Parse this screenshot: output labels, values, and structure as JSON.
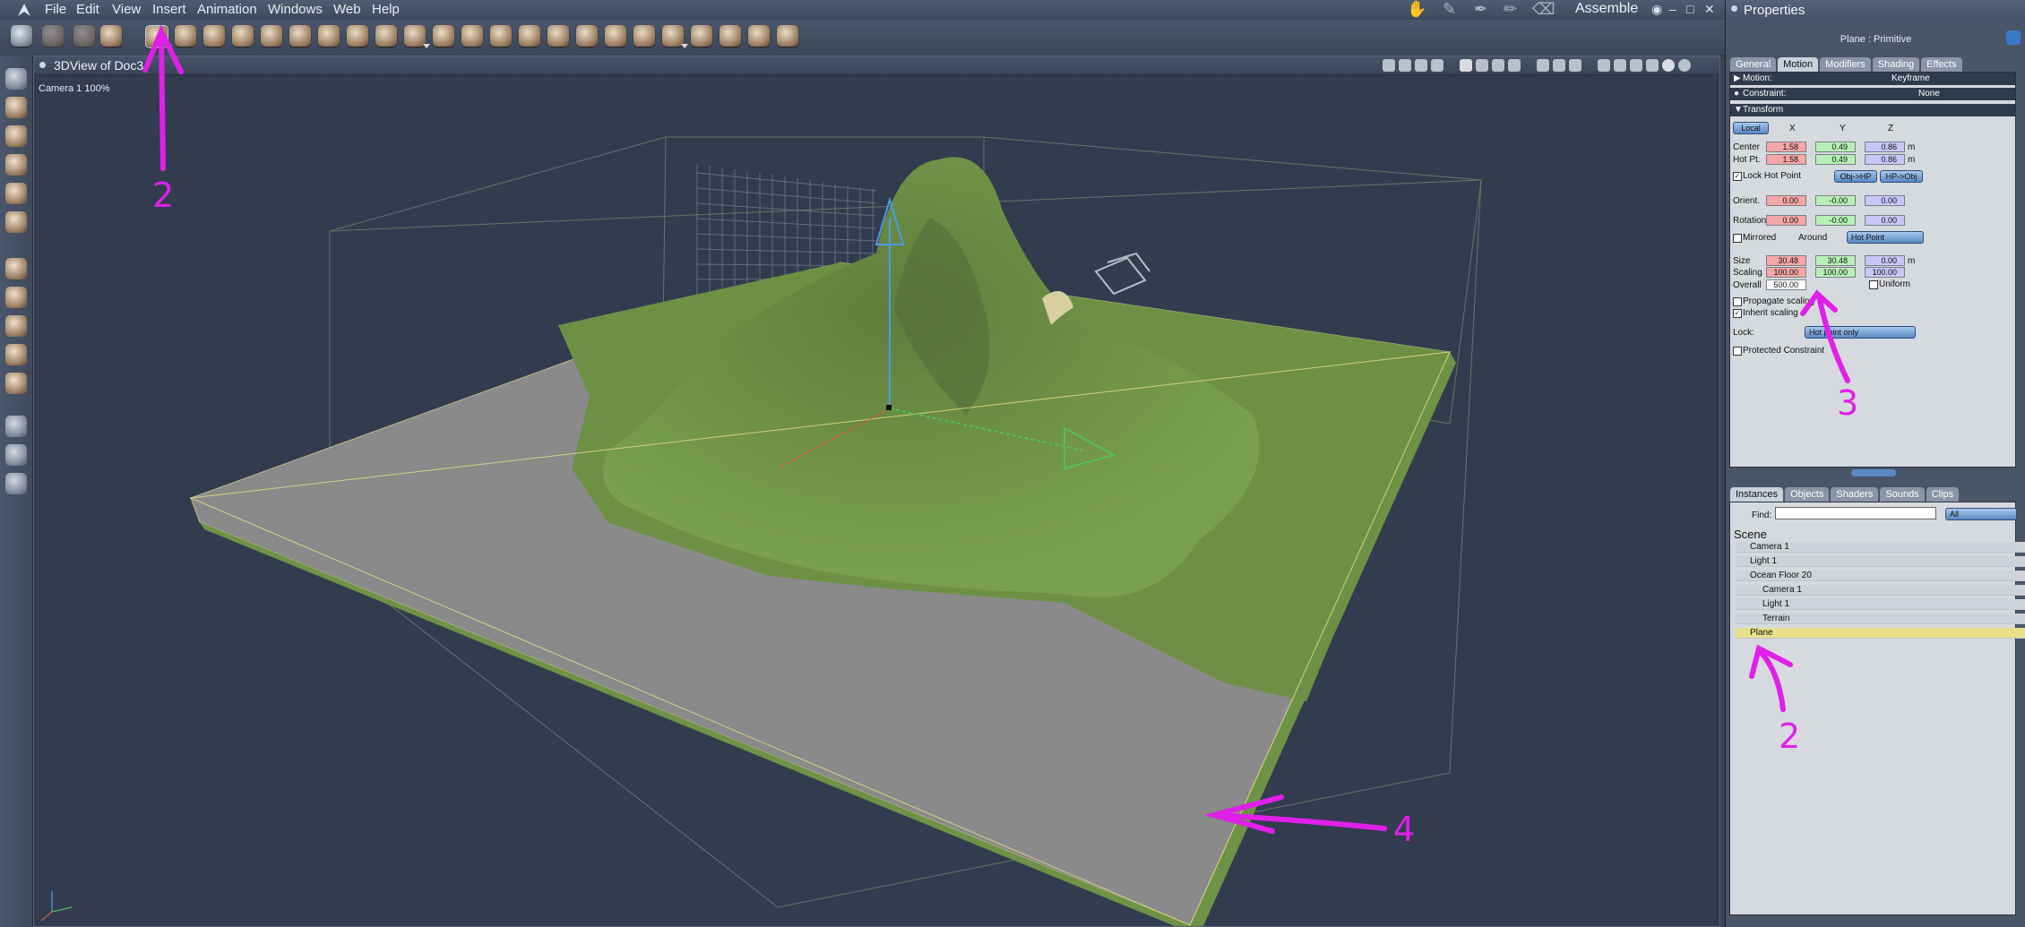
{
  "menubar": {
    "items": [
      "File",
      "Edit",
      "View",
      "Insert",
      "Animation",
      "Windows",
      "Web",
      "Help"
    ],
    "room": "Assemble"
  },
  "viewport": {
    "title": "3DView of Doc3",
    "camera_label": "Camera 1 100%"
  },
  "properties": {
    "title": "Properties",
    "object_label": "Plane : Primitive",
    "tabs": [
      "General",
      "Motion",
      "Modifiers",
      "Shading",
      "Effects"
    ],
    "motion_label": "Motion:",
    "motion_value": "Keyframe",
    "constraint_label": "Constraint:",
    "constraint_value": "None",
    "transform_label": "Transform",
    "space_value": "Local",
    "axis_x": "X",
    "axis_y": "Y",
    "axis_z": "Z",
    "center_label": "Center",
    "center": [
      "1.58",
      "0.49",
      "0.86"
    ],
    "hotpt_label": "Hot Pt.",
    "hotpt": [
      "1.58",
      "0.49",
      "0.86"
    ],
    "unit_m": "m",
    "lock_hot_point": "Lock Hot Point",
    "obj_hp_btn": "Obj->HP",
    "hp_obj_btn": "HP->Obj",
    "orient_label": "Orient.",
    "orient": [
      "0.00",
      "-0.00",
      "0.00"
    ],
    "rotation_label": "Rotation",
    "rotation": [
      "0.00",
      "-0.00",
      "0.00"
    ],
    "mirrored_label": "Mirrored",
    "around_label": "Around",
    "around_value": "Hot Point",
    "size_label": "Size",
    "size": [
      "30.48",
      "30.48",
      "0.00"
    ],
    "scaling_label": "Scaling",
    "scaling": [
      "100.00",
      "100.00",
      "100.00"
    ],
    "overall_label": "Overall",
    "overall_value": "500.00",
    "uniform_label": "Uniform",
    "propagate_label": "Propagate scaling",
    "inherit_label": "Inherit scaling",
    "lock_label": "Lock:",
    "lock_value": "Hot point only",
    "protected_label": "Protected Constraint"
  },
  "browser": {
    "tabs": [
      "Instances",
      "Objects",
      "Shaders",
      "Sounds",
      "Clips"
    ],
    "find_label": "Find:",
    "filter_value": "All",
    "scene_label": "Scene",
    "items": [
      "Camera 1",
      "Light 1",
      "Ocean Floor 20",
      "Camera 1",
      "Light 1",
      "Terrain",
      "Plane"
    ]
  },
  "annotations": {
    "toolbar_marker": "2",
    "property_marker": "3",
    "plane_marker": "2",
    "viewport_marker": "4"
  },
  "colors": {
    "annotation": "#e020e8",
    "selection": "#e8e08a",
    "terrain": "#6a8c44",
    "plane": "#8a8a8a"
  }
}
